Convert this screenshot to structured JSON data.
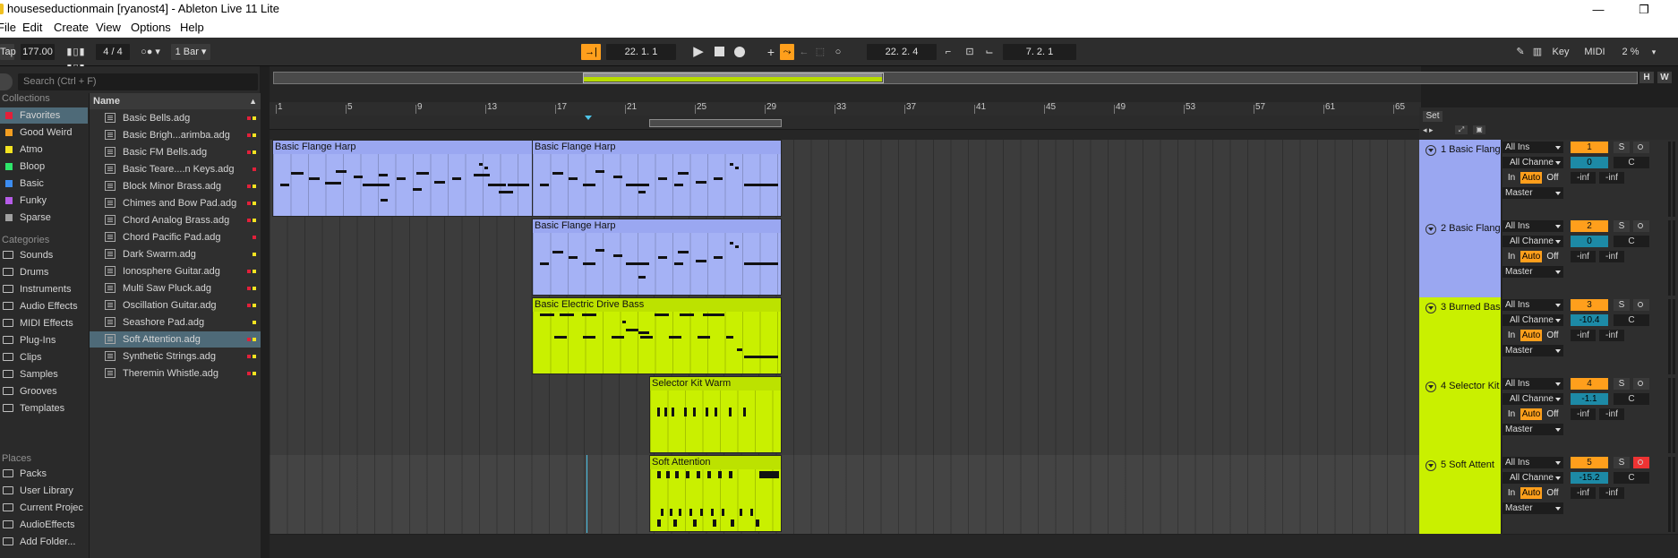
{
  "window": {
    "title": "houseseductionmain  [ryanost4] - Ableton Live 11 Lite",
    "minimize": "—",
    "maximize": "❐",
    "close": "✕"
  },
  "menu": [
    "File",
    "Edit",
    "Create",
    "View",
    "Options",
    "Help"
  ],
  "transport": {
    "tap": "Tap",
    "tempo": "177.00",
    "signature": "4 / 4",
    "quantize": "1 Bar",
    "arrangement_position": "22.  1.  1",
    "loop_start": "22.  2.  4",
    "loop_length": "7.  2.  1",
    "key_label": "Key",
    "midi_label": "MIDI",
    "cpu": "2 %"
  },
  "browser": {
    "search_placeholder": "Search (Ctrl + F)",
    "collections_heading": "Collections",
    "collections": [
      {
        "label": "Favorites",
        "color": "#e2203a",
        "selected": true
      },
      {
        "label": "Good Weird",
        "color": "#f39e21"
      },
      {
        "label": "Atmo",
        "color": "#f3e321"
      },
      {
        "label": "Bloop",
        "color": "#2ee56a"
      },
      {
        "label": "Basic",
        "color": "#3c8cf0"
      },
      {
        "label": "Funky",
        "color": "#b65ce8"
      },
      {
        "label": "Sparse",
        "color": "#a0a0a0"
      }
    ],
    "categories_heading": "Categories",
    "categories": [
      "Sounds",
      "Drums",
      "Instruments",
      "Audio Effects",
      "MIDI Effects",
      "Plug-Ins",
      "Clips",
      "Samples",
      "Grooves",
      "Templates"
    ],
    "places_heading": "Places",
    "places": [
      "Packs",
      "User Library",
      "Current Projec",
      "AudioEffects",
      "Add Folder..."
    ],
    "name_header": "Name",
    "files": [
      "Basic Bells.adg",
      "Basic Brigh...arimba.adg",
      "Basic FM Bells.adg",
      "Basic Teare....n Keys.adg",
      "Block Minor Brass.adg",
      "Chimes and Bow Pad.adg",
      "Chord Analog Brass.adg",
      "Chord Pacific Pad.adg",
      "Dark Swarm.adg",
      "Ionosphere Guitar.adg",
      "Multi Saw Pluck.adg",
      "Oscillation Guitar.adg",
      "Seashore Pad.adg",
      "Soft Attention.adg",
      "Synthetic Strings.adg",
      "Theremin Whistle.adg"
    ]
  },
  "ruler": [
    "1",
    "5",
    "9",
    "13",
    "17",
    "21",
    "25",
    "29",
    "33",
    "37",
    "41",
    "45",
    "49",
    "53",
    "57",
    "61",
    "65"
  ],
  "overview_buttons": [
    "H",
    "W"
  ],
  "set_label": "Set",
  "tracks": [
    {
      "name": "1 Basic Flang",
      "number": "1",
      "volume": "0",
      "input": "All Ins",
      "channel": "All Channe",
      "output": "Master",
      "pan": "C",
      "peak1": "-inf",
      "peak2": "-inf",
      "armed": false
    },
    {
      "name": "2 Basic Flang",
      "number": "2",
      "volume": "0",
      "input": "All Ins",
      "channel": "All Channe",
      "output": "Master",
      "pan": "C",
      "peak1": "-inf",
      "peak2": "-inf",
      "armed": false
    },
    {
      "name": "3 Burned Bas",
      "number": "3",
      "volume": "-10.4",
      "input": "All Ins",
      "channel": "All Channe",
      "output": "Master",
      "pan": "C",
      "peak1": "-inf",
      "peak2": "-inf",
      "armed": false
    },
    {
      "name": "4 Selector Kit",
      "number": "4",
      "volume": "-1.1",
      "input": "All Ins",
      "channel": "All Channe",
      "output": "Master",
      "pan": "C",
      "peak1": "-inf",
      "peak2": "-inf",
      "armed": false
    },
    {
      "name": "5 Soft Attent",
      "number": "5",
      "volume": "-15.2",
      "input": "All Ins",
      "channel": "All Channe",
      "output": "Master",
      "pan": "C",
      "peak1": "-inf",
      "peak2": "-inf",
      "armed": true
    }
  ],
  "monitor": {
    "in": "In",
    "auto": "Auto",
    "off": "Off",
    "solo": "S"
  },
  "clips": [
    {
      "title": "Basic Flange Harp"
    },
    {
      "title": "Basic Flange Harp"
    },
    {
      "title": "Basic Flange Harp"
    },
    {
      "title": "Basic Electric Drive Bass"
    },
    {
      "title": "Selector Kit Warm"
    },
    {
      "title": "Soft Attention"
    }
  ]
}
